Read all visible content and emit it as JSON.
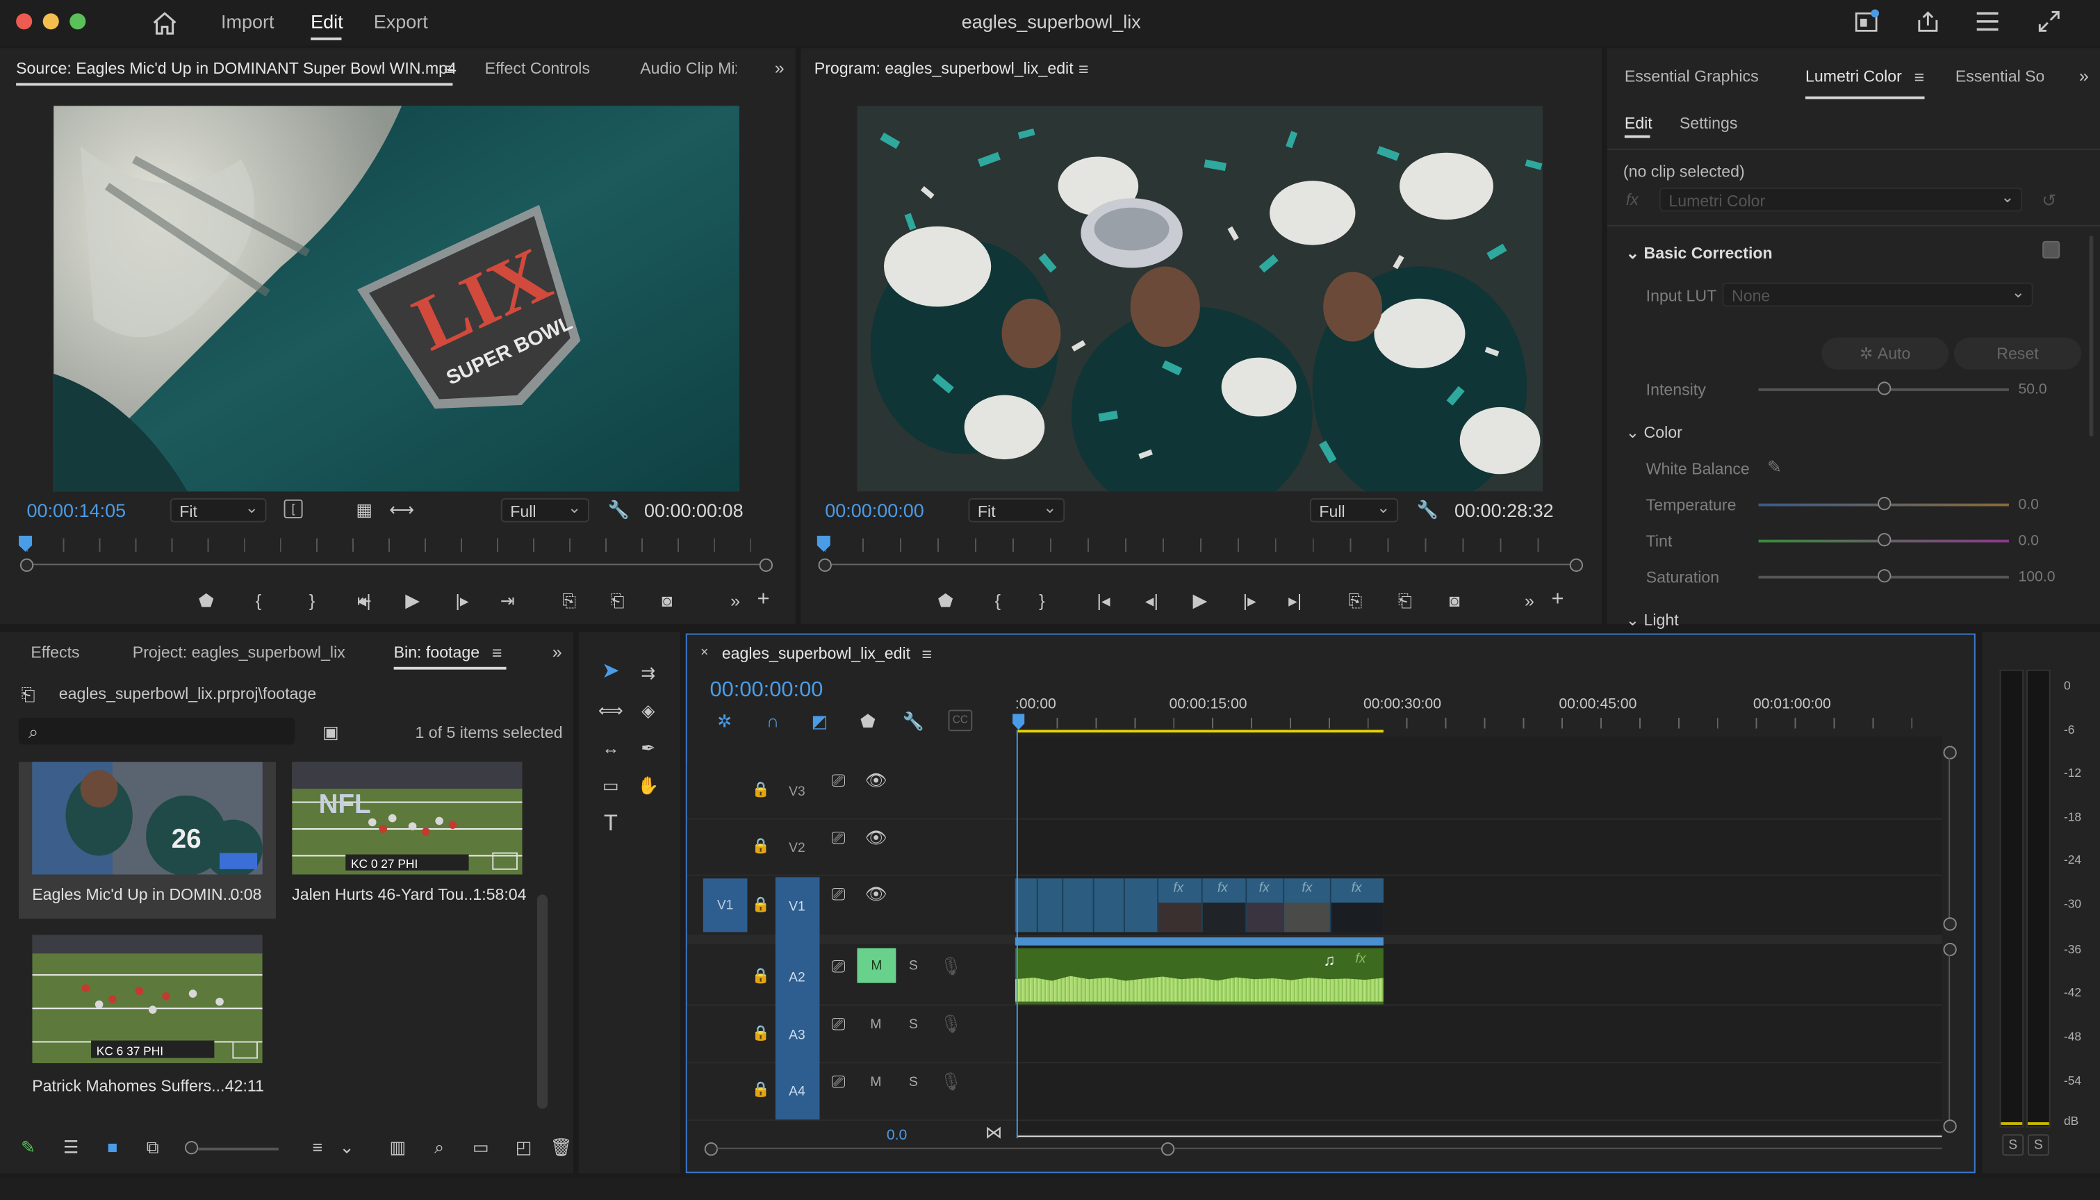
{
  "title_bar": {
    "project_title": "eagles_superbowl_lix",
    "tabs": [
      "Import",
      "Edit",
      "Export"
    ],
    "active_tab": "Edit"
  },
  "source_panel": {
    "tab_label": "Source: Eagles Mic'd Up in DOMINANT Super Bowl WIN.mp4",
    "tabs": [
      "Effect Controls",
      "Audio Clip Mix"
    ],
    "timecode": "00:00:14:05",
    "fit": "Fit",
    "quality": "Full",
    "duration": "00:00:00:08"
  },
  "program_panel": {
    "tab_label": "Program: eagles_superbowl_lix_edit",
    "timecode": "00:00:00:00",
    "fit": "Fit",
    "quality": "Full",
    "duration": "00:00:28:32"
  },
  "right_panel": {
    "tabs": [
      "Essential Graphics",
      "Lumetri Color",
      "Essential Sou"
    ],
    "active_tab": "Lumetri Color",
    "subtabs": [
      "Edit",
      "Settings"
    ],
    "no_clip": "(no clip selected)",
    "fx_label": "fx",
    "effect_select": "Lumetri Color",
    "basic_correction": "Basic Correction",
    "input_lut_label": "Input LUT",
    "input_lut_value": "None",
    "auto_btn": "Auto",
    "reset_btn": "Reset",
    "intensity_label": "Intensity",
    "intensity_value": "50.0",
    "intensity": 0.5,
    "color_section": "Color",
    "white_balance": "White Balance",
    "temperature_label": "Temperature",
    "temperature_value": "0.0",
    "tint_label": "Tint",
    "tint_value": "0.0",
    "saturation_label": "Saturation",
    "saturation_value": "100.0",
    "light_section": "Light"
  },
  "project_panel": {
    "tabs": [
      "Effects",
      "Project: eagles_superbowl_lix",
      "Bin: footage"
    ],
    "active_tab": "Bin: footage",
    "path": "eagles_superbowl_lix.prproj\\footage",
    "selection_info": "1 of 5 items selected",
    "items": [
      {
        "name": "Eagles Mic'd Up in DOMIN...",
        "duration": "0:08"
      },
      {
        "name": "Jalen Hurts 46-Yard Tou...",
        "duration": "1:58:04"
      },
      {
        "name": "Patrick Mahomes Suffers...",
        "duration": "42:11"
      }
    ],
    "scoreboard1": "KC 0 27 PHI",
    "scoreboard2": "KC 6 37 PHI",
    "thumb_badge": "NFL"
  },
  "timeline": {
    "sequence_name": "eagles_superbowl_lix_edit",
    "timecode": "00:00:00:00",
    "ruler_labels": [
      ":00:00",
      "00:00:15:00",
      "00:00:30:00",
      "00:00:45:00",
      "00:01:00:00"
    ],
    "video_tracks": [
      "V3",
      "V2",
      "V1"
    ],
    "audio_tracks": [
      "A2",
      "A3",
      "A4"
    ],
    "source_patch_video": "V1",
    "mute_label": "M",
    "solo_label": "S",
    "fx_badge": "fx",
    "master_value": "0.0",
    "cc_label": "CC"
  },
  "meter": {
    "labels": [
      "0",
      "-6",
      "-12",
      "-18",
      "-24",
      "-30",
      "-36",
      "-42",
      "-48",
      "-54",
      "dB"
    ],
    "solo_left": "S",
    "solo_right": "S"
  },
  "colors": {
    "accent": "#4b9ce6",
    "panel": "#232323",
    "background": "#1b1b1b",
    "audio_clip": "#3c6a1f",
    "video_clip": "#2c5d80",
    "playhead_yellow": "#e8d400"
  }
}
